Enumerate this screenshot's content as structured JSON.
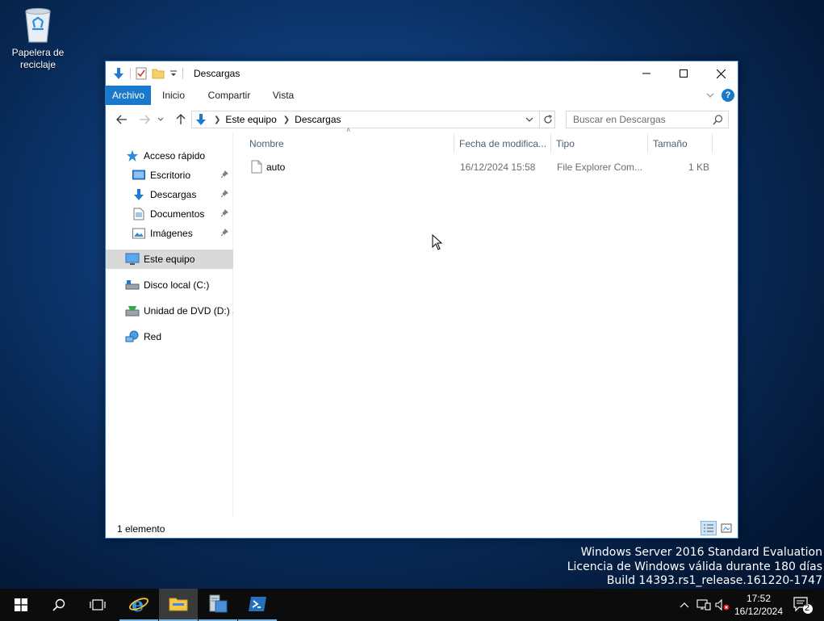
{
  "desktop": {
    "recycle_bin_label_line1": "Papelera de",
    "recycle_bin_label_line2": "reciclaje"
  },
  "window": {
    "title": "Descargas",
    "controls": {
      "minimize": "minimize-icon",
      "maximize": "maximize-icon",
      "close": "close-icon"
    }
  },
  "ribbon": {
    "tabs": [
      {
        "label": "Archivo",
        "active": true
      },
      {
        "label": "Inicio"
      },
      {
        "label": "Compartir"
      },
      {
        "label": "Vista"
      }
    ],
    "help_label": "?"
  },
  "address_bar": {
    "crumbs": [
      "Este equipo",
      "Descargas"
    ],
    "search_placeholder": "Buscar en Descargas"
  },
  "nav_pane": {
    "quick_access": "Acceso rápido",
    "items": [
      {
        "label": "Escritorio",
        "pinned": true
      },
      {
        "label": "Descargas",
        "pinned": true
      },
      {
        "label": "Documentos",
        "pinned": true
      },
      {
        "label": "Imágenes",
        "pinned": true
      }
    ],
    "this_pc": "Este equipo",
    "local_disk": "Disco local (C:)",
    "dvd_drive": "Unidad de DVD (D:) S",
    "network": "Red"
  },
  "columns": {
    "name": "Nombre",
    "date": "Fecha de modifica...",
    "type": "Tipo",
    "size": "Tamaño"
  },
  "files": [
    {
      "name": "auto",
      "date": "16/12/2024 15:58",
      "type": "File Explorer Com...",
      "size": "1 KB"
    }
  ],
  "status": {
    "count": "1 elemento"
  },
  "watermark": {
    "line1": "Windows Server 2016 Standard Evaluation",
    "line2": "Licencia de Windows válida durante 180 días",
    "line3": "Build 14393.rs1_release.161220-1747"
  },
  "taskbar": {
    "clock_time": "17:52",
    "clock_date": "16/12/2024",
    "notification_count": "2"
  },
  "colors": {
    "accent": "#1979ca",
    "selection": "#d9d9d9",
    "header_text": "#4c607a"
  }
}
